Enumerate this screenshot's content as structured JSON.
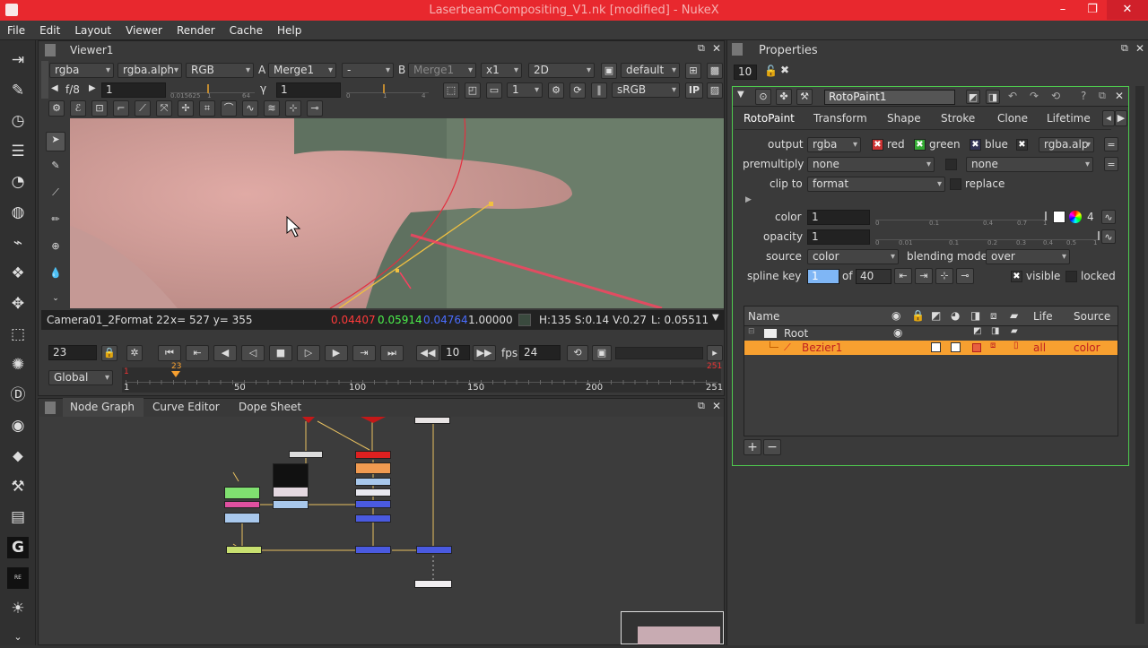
{
  "window": {
    "title": "LaserbeamCompositing_V1.nk [modified] - NukeX",
    "controls": [
      "–",
      "❐",
      "✕"
    ]
  },
  "menu": [
    "File",
    "Edit",
    "Layout",
    "Viewer",
    "Render",
    "Cache",
    "Help"
  ],
  "viewer": {
    "tab": "Viewer1",
    "channels": "rgba",
    "alpha": "rgba.alph",
    "display": "RGB",
    "a_label": "A",
    "a_input": "Merge1",
    "wipe": "-",
    "b_label": "B",
    "b_input": "Merge1",
    "zoom": "x1",
    "mode": "2D",
    "lut_profile": "default",
    "fstop": "f/8",
    "gain_value": "1",
    "gain_ticks": [
      "0.015625",
      "1",
      "64"
    ],
    "gamma_label": "γ",
    "gamma_value": "1",
    "gamma_ticks": [
      "0",
      "1",
      "4"
    ],
    "proxy_value": "1",
    "colorspace": "sRGB",
    "ip_label": "IP",
    "status_format": "Camera01_2Format 22",
    "status_xy": "x= 527 y= 355",
    "status_r": "0.04407",
    "status_g": "0.05914",
    "status_b": "0.04764",
    "status_a": "1.00000",
    "status_hsv": "H:135 S:0.14 V:0.27",
    "status_l": "L: 0.05511"
  },
  "timeline": {
    "frame": "23",
    "step": "10",
    "fps_label": "fps",
    "fps": "24",
    "scope": "Global",
    "ticks": [
      "1",
      "50",
      "100",
      "150",
      "200",
      "251"
    ],
    "in_mark": "1",
    "current_mark": "23",
    "out_mark": "251"
  },
  "graph_tabs": [
    "Node Graph",
    "Curve Editor",
    "Dope Sheet"
  ],
  "properties": {
    "title": "Properties",
    "max_panels": "10",
    "node_name": "RotoPaint1",
    "tabs": [
      "RotoPaint",
      "Transform",
      "Shape",
      "Stroke",
      "Clone",
      "Lifetime"
    ],
    "output_label": "output",
    "output_value": "rgba",
    "ch_red": "red",
    "ch_green": "green",
    "ch_blue": "blue",
    "ch_alpha": "rgba.alp",
    "premult_label": "premultiply",
    "premult_value": "none",
    "premult_value2": "none",
    "clip_label": "clip to",
    "clip_value": "format",
    "replace_label": "replace",
    "color_label": "color",
    "color_value": "1",
    "color_count": "4",
    "color_ticks": [
      "0",
      "0.1",
      "0.4",
      "0.7",
      "1"
    ],
    "opacity_label": "opacity",
    "opacity_value": "1",
    "opacity_ticks": [
      "0",
      "0.01",
      "0.1",
      "0.2",
      "0.3",
      "0.4",
      "0.5",
      "1"
    ],
    "source_label": "source",
    "source_value": "color",
    "blend_label": "blending mode",
    "blend_value": "over",
    "spline_label": "spline key",
    "spline_value": "1",
    "spline_of": "of",
    "spline_total": "40",
    "visible_label": "visible",
    "locked_label": "locked",
    "columns": [
      "Name",
      "Life",
      "Source"
    ],
    "rows": [
      {
        "name": "Root",
        "life": "",
        "source": ""
      },
      {
        "name": "Bezier1",
        "life": "all",
        "source": "color"
      }
    ],
    "add": "+",
    "remove": "−"
  },
  "colors": {
    "accent": "#f7a030",
    "titlebar": "#e8282e",
    "panel_border": "#4ecb4e"
  }
}
